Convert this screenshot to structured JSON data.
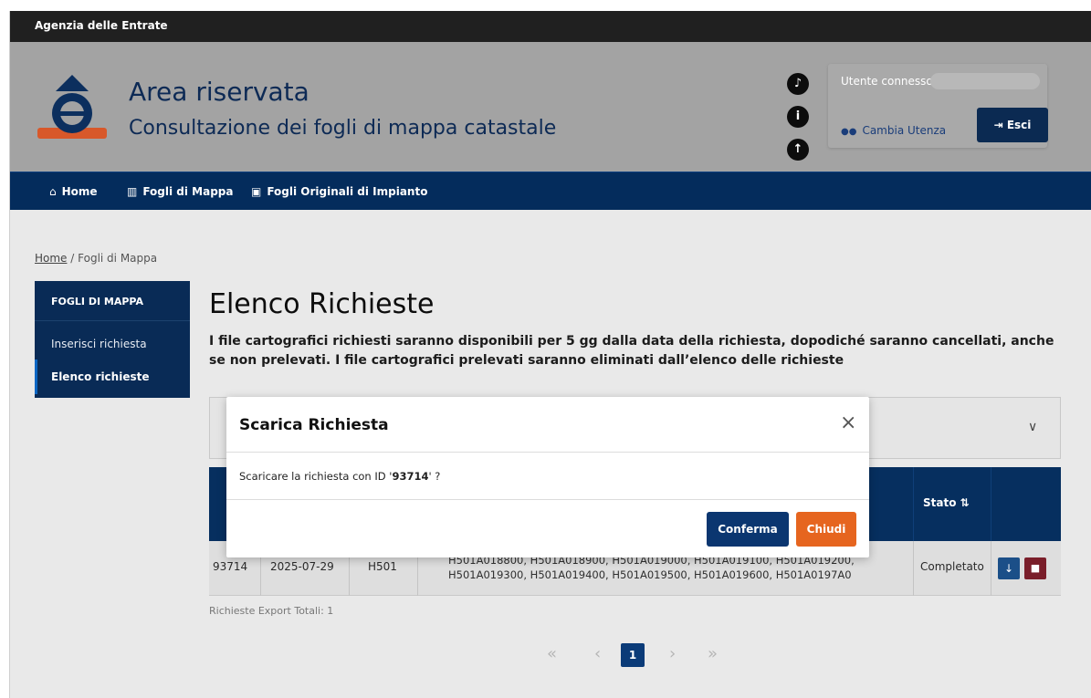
{
  "topbar": {
    "agency": "Agenzia delle Entrate"
  },
  "header": {
    "title": "Area riservata",
    "subtitle": "Consultazione dei fogli di mappa catastale",
    "icons": [
      "bell-icon",
      "info-icon",
      "upload-icon"
    ],
    "user_label": "Utente connesso:",
    "switch_label": "Cambia Utenza",
    "logout_label": "Esci"
  },
  "nav": {
    "items": [
      {
        "label": "Home",
        "icon": "home-icon"
      },
      {
        "label": "Fogli di Mappa",
        "icon": "map-icon"
      },
      {
        "label": "Fogli Originali di Impianto",
        "icon": "image-icon"
      }
    ]
  },
  "breadcrumb": {
    "home": "Home",
    "separator": "/",
    "current": "Fogli di Mappa"
  },
  "sidebar": {
    "header": "FOGLI DI MAPPA",
    "items": [
      {
        "label": "Inserisci richiesta"
      },
      {
        "label": "Elenco richieste",
        "active": true
      }
    ]
  },
  "main": {
    "title": "Elenco Richieste",
    "description": "I file cartografici richiesti saranno disponibili per 5 gg dalla data della richiesta, dopodiché saranno cancellati, anche se non prelevati. I file cartografici prelevati saranno eliminati dall’elenco delle richieste"
  },
  "table": {
    "header_visible": [
      "Stato ⇅"
    ],
    "rows": [
      {
        "id": "93714",
        "date": "2025-07-29",
        "code": "H501",
        "sheets_line1": "H501A018800, H501A018900, H501A019000, H501A019100, H501A019200,",
        "sheets_line2": "H501A019300, H501A019400, H501A019500, H501A019600, H501A0197A0",
        "status": "Completato"
      }
    ],
    "total_label": "Richieste Export Totali: 1"
  },
  "pagination": {
    "first": "«",
    "prev": "‹",
    "current": "1",
    "next": "›",
    "last": "»"
  },
  "modal": {
    "title": "Scarica Richiesta",
    "close": "×",
    "body_prefix": "Scaricare la richiesta con ID '",
    "body_id": "93714",
    "body_suffix": "' ?",
    "confirm_label": "Conferma",
    "close_label": "Chiudi"
  },
  "colors": {
    "navy": "#042c5c",
    "orange": "#e6651f",
    "danger": "#7a1e2a"
  }
}
